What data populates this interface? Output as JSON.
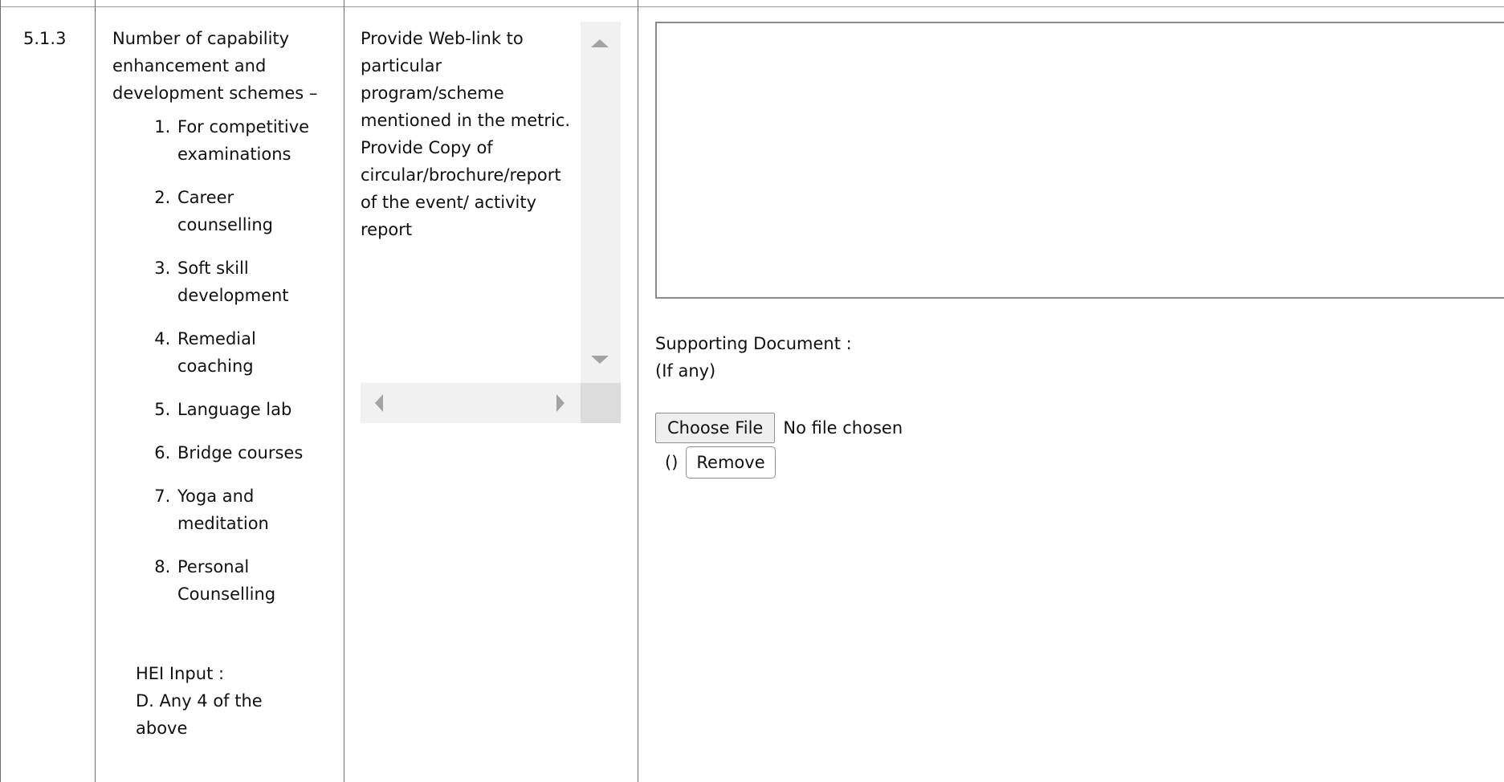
{
  "row": {
    "serial": "5.1.3",
    "metric": {
      "heading": "Number of capability enhancement and development schemes –",
      "items": [
        "For competitive examinations",
        "Career counselling",
        "Soft skill development",
        "Remedial coaching",
        "Language lab",
        "Bridge courses",
        "Yoga and meditation",
        "Personal Counselling"
      ],
      "hei_input_label": "HEI Input :",
      "hei_input_value": "D. Any 4 of the above"
    },
    "documents_required": "Provide Web-link to particular program/scheme mentioned in the metric. Provide Copy of circular/brochure/report of the event/ activity report",
    "response": {
      "text_value": "",
      "supporting_document_label": "Supporting Document :",
      "supporting_document_note": "(If any)",
      "choose_file_label": "Choose File",
      "file_status": "No file chosen",
      "file_name_display": "()",
      "remove_label": "Remove"
    }
  },
  "icons": {
    "scroll_up": "triangle-up-icon",
    "scroll_down": "triangle-down-icon",
    "scroll_left": "triangle-left-icon",
    "scroll_right": "triangle-right-icon"
  },
  "colors": {
    "border": "#6d6d6d",
    "scrollbar_track": "#f1f1f1",
    "scrollbar_arrow": "#a3a3a3",
    "button_bg": "#efefef"
  }
}
